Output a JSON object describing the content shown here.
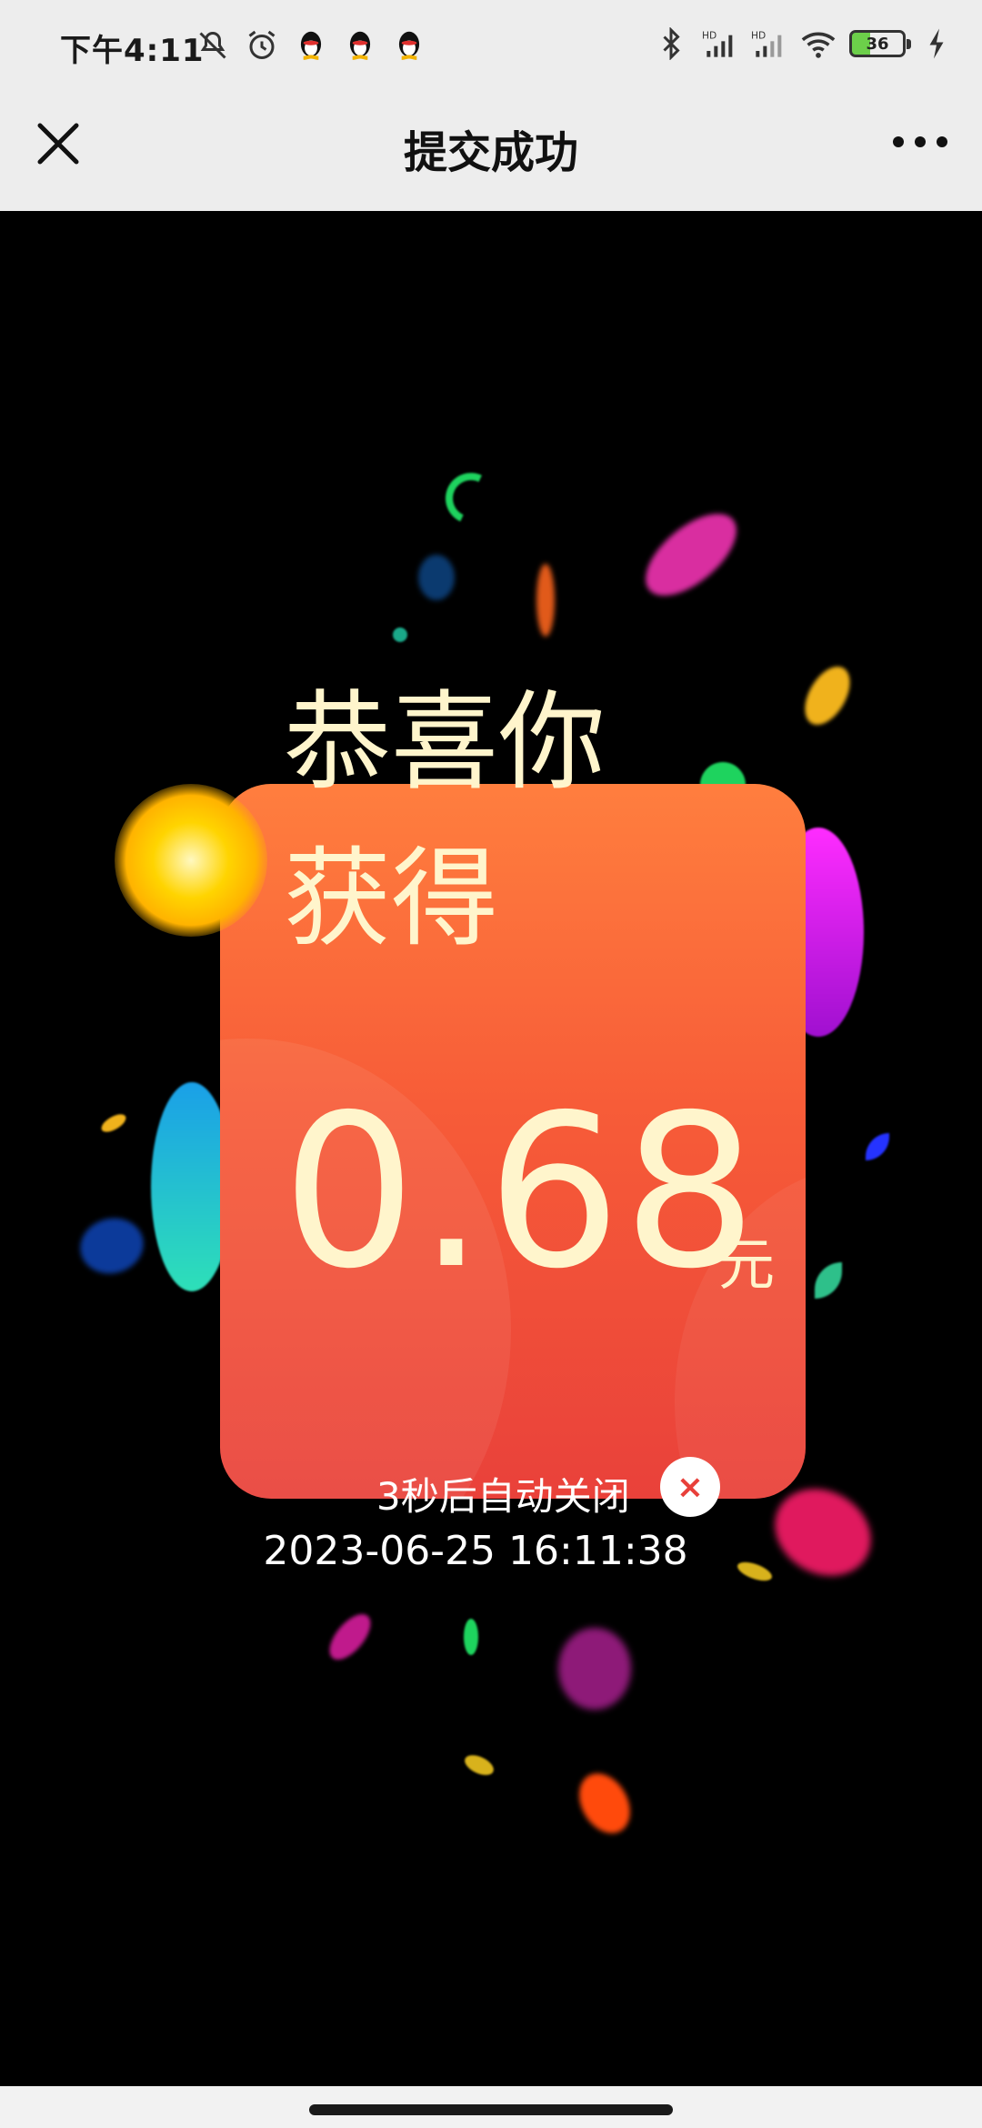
{
  "status_bar": {
    "time": "下午4:11",
    "battery_level": "36",
    "icons_left": [
      "mute-icon",
      "alarm-icon",
      "qq-icon",
      "qq-icon",
      "qq-icon"
    ],
    "icons_right": [
      "bluetooth-icon",
      "signal-hd-icon",
      "signal-hd-icon",
      "wifi-icon",
      "battery-icon",
      "charging-icon"
    ]
  },
  "nav": {
    "title": "提交成功",
    "close_icon": "close-icon",
    "more_icon": "more-icon"
  },
  "reward": {
    "congrats": "恭喜你",
    "obtained": "获得",
    "amount": "0.68",
    "unit": "元",
    "auto_close_text": "3秒后自动关闭",
    "close_symbol": "×",
    "timestamp": "2023-06-25 16:11:38"
  },
  "colors": {
    "card_top": "#ff7e3e",
    "card_bottom": "#e9413a",
    "text_cream": "#fff5cc",
    "nav_bg": "#ededed"
  }
}
